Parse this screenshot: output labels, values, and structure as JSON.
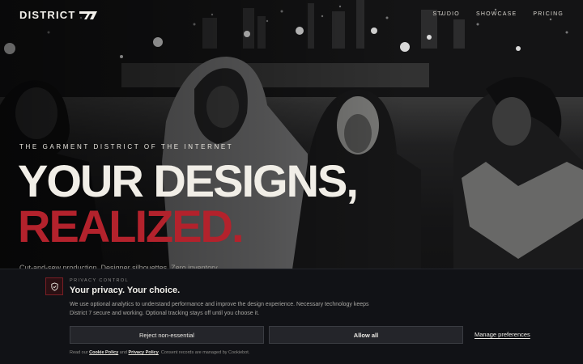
{
  "brand": {
    "name": "DISTRICT",
    "mark_icon": "district-7-slash-mark"
  },
  "nav": {
    "items": [
      {
        "label": "STUDIO"
      },
      {
        "label": "SHOWCASE"
      },
      {
        "label": "PRICING"
      }
    ]
  },
  "hero": {
    "eyebrow": "THE GARMENT DISTRICT OF THE INTERNET",
    "headline_line1": "YOUR DESIGNS,",
    "headline_line2": "REALIZED.",
    "subtext": "Cut-and-sew production. Designer silhouettes. Zero inventory."
  },
  "consent": {
    "icon": "shield-check-icon",
    "eyebrow": "PRIVACY CONTROL",
    "title": "Your privacy. Your choice.",
    "body": "We use optional analytics to understand performance and improve the design experience. Necessary technology keeps District 7 secure and working. Optional tracking stays off until you choose it.",
    "reject_label": "Reject non-essential",
    "allow_label": "Allow all",
    "manage_label": "Manage preferences",
    "footer_prefix": "Read our",
    "cookie_policy_label": "Cookie Policy",
    "footer_and": "and",
    "privacy_policy_label": "Privacy Policy",
    "footer_suffix": ". Consent records are managed by Cookiebot."
  },
  "colors": {
    "accent_red": "#b3222c",
    "headline_light": "#f1eee7",
    "panel_bg": "#111216",
    "button_bg": "#24252a"
  }
}
